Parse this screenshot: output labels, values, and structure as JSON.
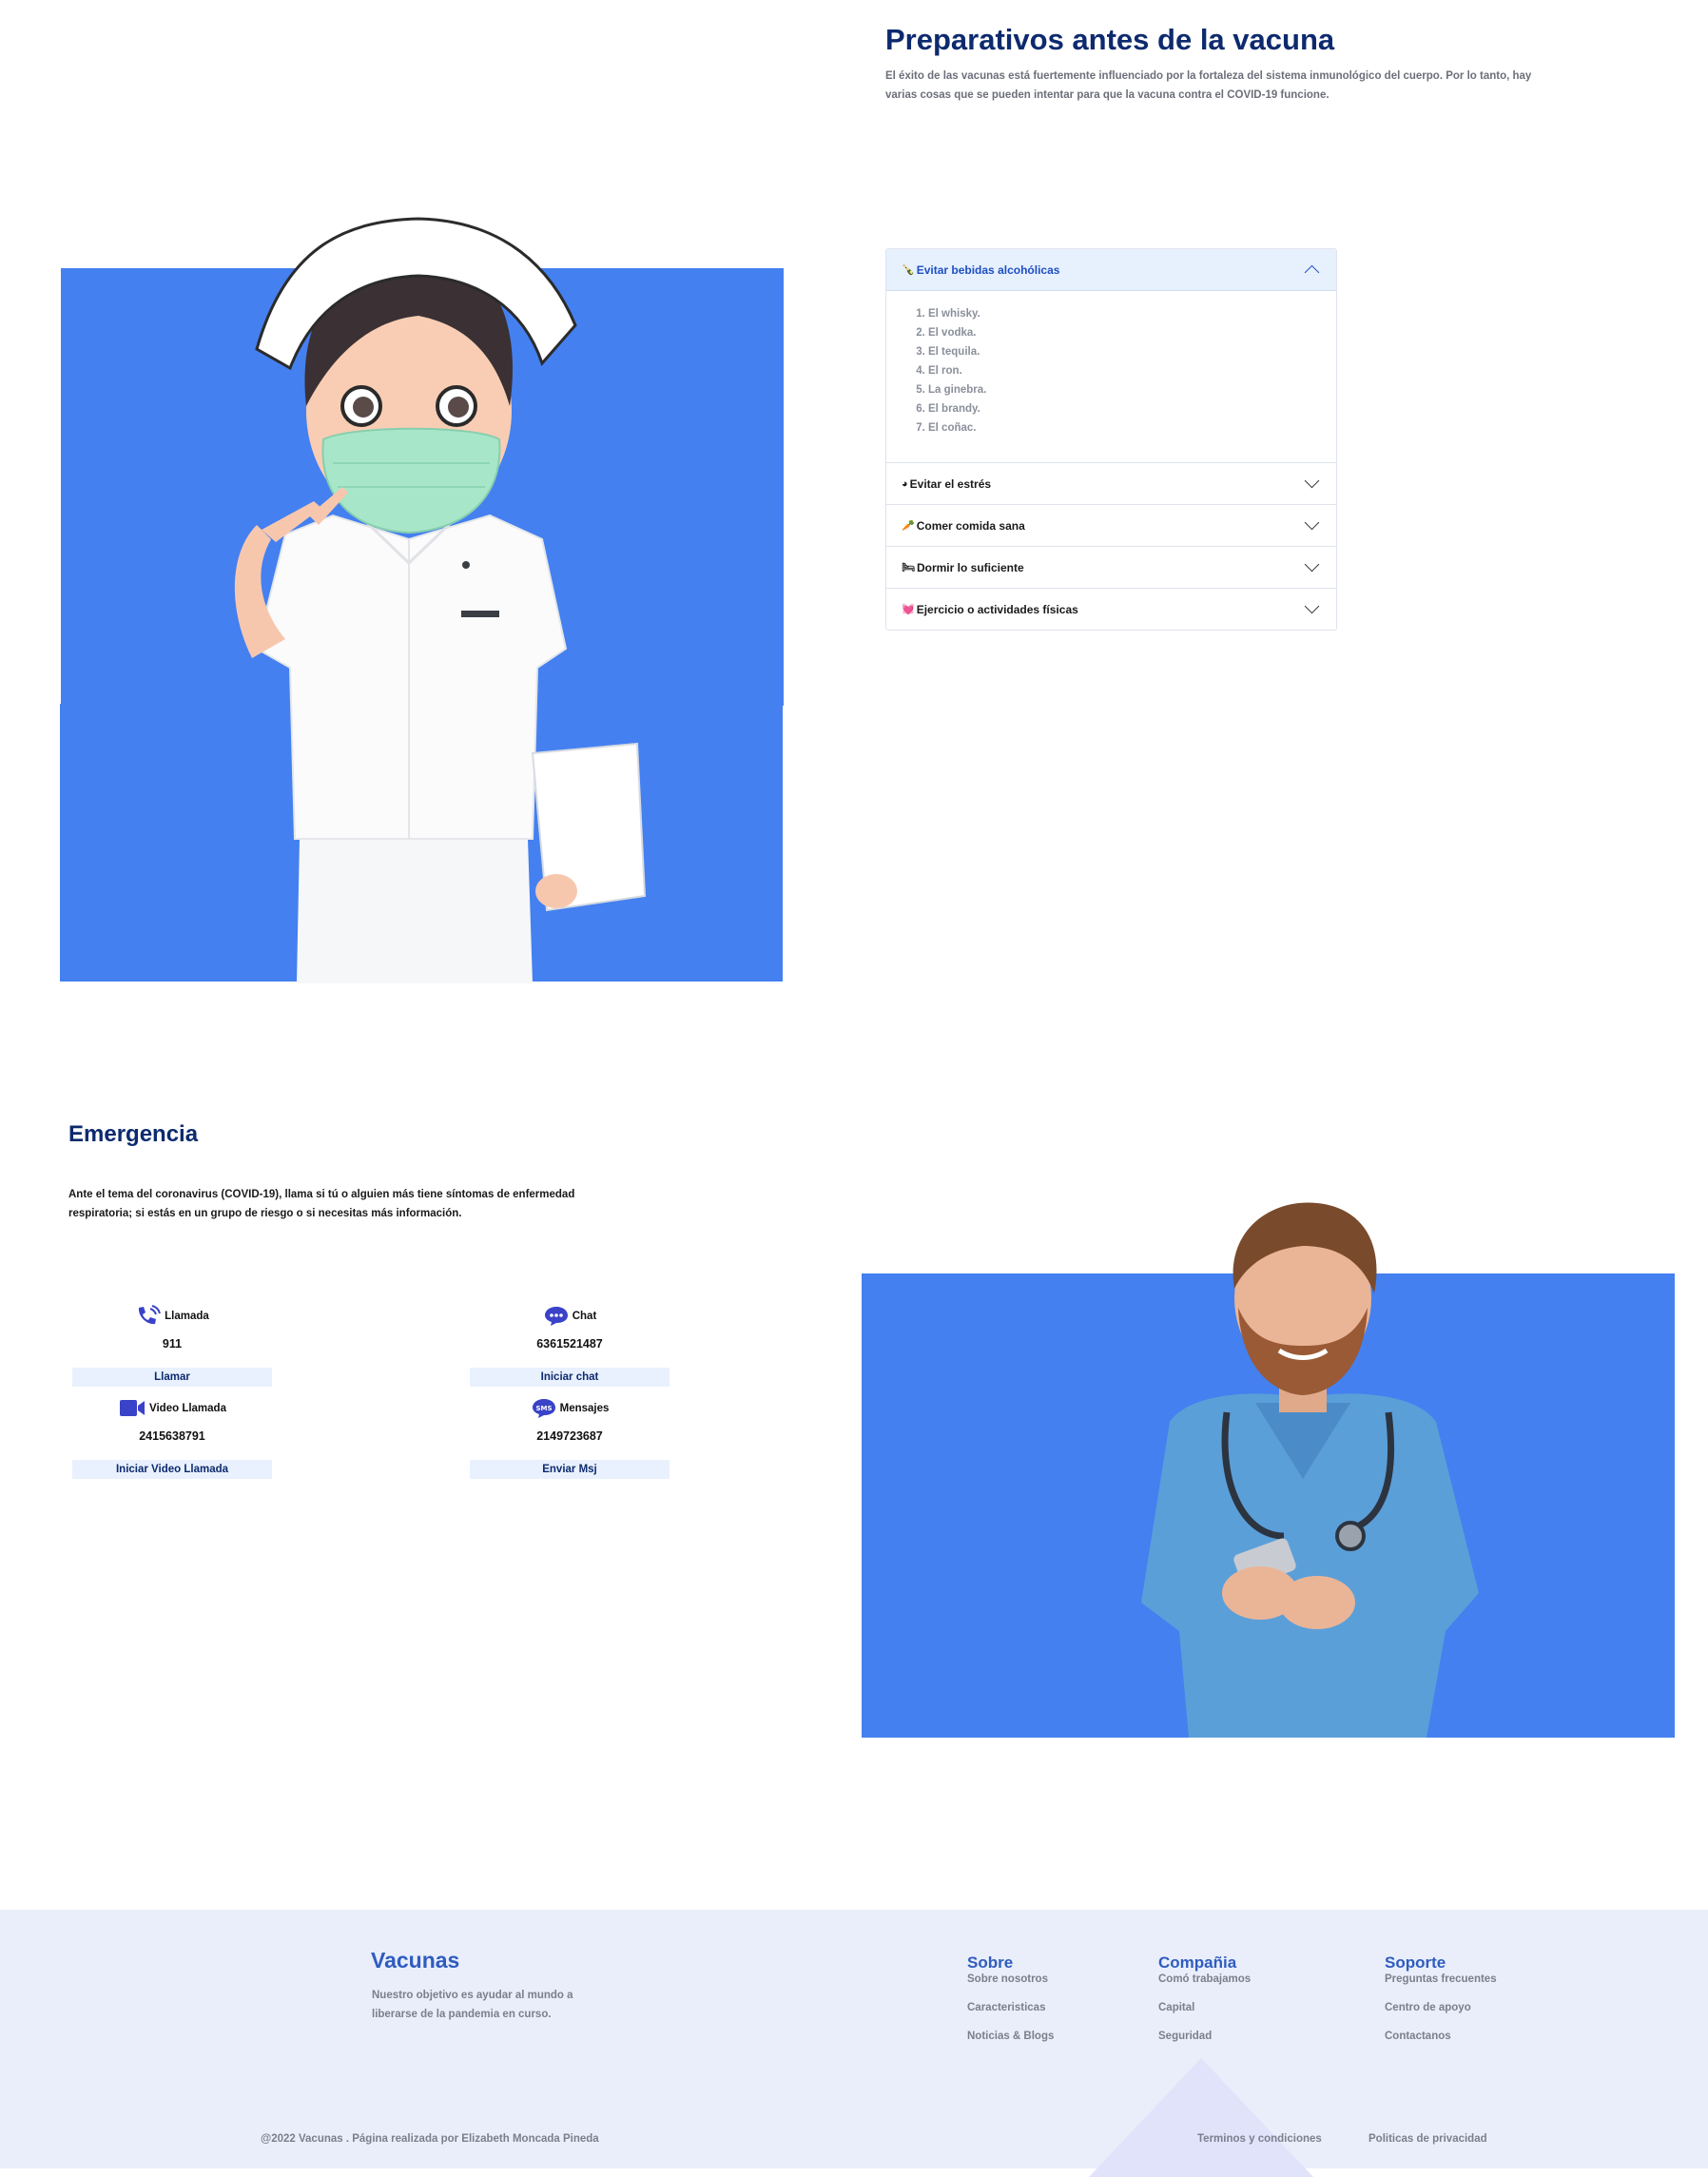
{
  "prep": {
    "title": "Preparativos antes de la vacuna",
    "description": "El éxito de las vacunas está fuertemente influenciado por la fortaleza del sistema inmunológico del cuerpo. Por lo tanto, hay varias cosas que se pueden intentar para que la vacuna contra el COVID-19 funcione."
  },
  "accordion": {
    "items": [
      {
        "icon": "wine-bottle-icon",
        "glyph": "🍾",
        "label": "Evitar bebidas alcohólicas",
        "open": true,
        "list": [
          "El whisky.",
          "El vodka.",
          "El tequila.",
          "El ron.",
          "La ginebra.",
          "El brandy.",
          "El coñac."
        ]
      },
      {
        "icon": "stress-icon",
        "glyph": "◕",
        "label": "Evitar el estrés",
        "open": false
      },
      {
        "icon": "carrot-icon",
        "glyph": "🥕",
        "label": "Comer comida sana",
        "open": false
      },
      {
        "icon": "bed-icon",
        "glyph": "🛏",
        "label": "Dormir lo suficiente",
        "open": false
      },
      {
        "icon": "heartbeat-icon",
        "glyph": "💓",
        "label": "Ejercicio o actividades físicas",
        "open": false
      }
    ]
  },
  "emergency": {
    "title": "Emergencia",
    "description": "Ante el tema del coronavirus (COVID-19), llama si tú o alguien más tiene síntomas de enfermedad respiratoria; si estás en un grupo de riesgo o si necesitas más información.",
    "cards": [
      {
        "icon": "phone-call-icon",
        "label": "Llamada",
        "number": "911",
        "button": "Llamar"
      },
      {
        "icon": "chat-bubble-icon",
        "label": "Chat",
        "number": "6361521487",
        "button": "Iniciar chat"
      },
      {
        "icon": "video-camera-icon",
        "label": "Video Llamada",
        "number": "2415638791",
        "button": "Iniciar Video Llamada"
      },
      {
        "icon": "sms-icon",
        "label": "Mensajes",
        "number": "2149723687",
        "button": "Enviar Msj"
      }
    ]
  },
  "footer": {
    "brand": "Vacunas",
    "brand_description": "Nuestro objetivo es ayudar al mundo a liberarse de la pandemia en curso.",
    "columns": [
      {
        "title": "Sobre",
        "links": [
          "Sobre nosotros",
          "Caracteristicas",
          "Noticias & Blogs"
        ]
      },
      {
        "title": "Compañia",
        "links": [
          "Comó trabajamos",
          "Capital",
          "Seguridad"
        ]
      },
      {
        "title": "Soporte",
        "links": [
          "Preguntas frecuentes",
          "Centro de apoyo",
          "Contactanos"
        ]
      }
    ],
    "copyright": "@2022 Vacunas . Página realizada por Elizabeth Moncada Pineda",
    "terms": "Terminos y condiciones",
    "privacy": "Politicas de privacidad"
  },
  "colors": {
    "primary_dark": "#0d2a6e",
    "accent_blue": "#4480f0",
    "link_blue": "#2f5cbf",
    "footer_bg": "#e9eefa",
    "icon_purple": "#3a43c8"
  }
}
